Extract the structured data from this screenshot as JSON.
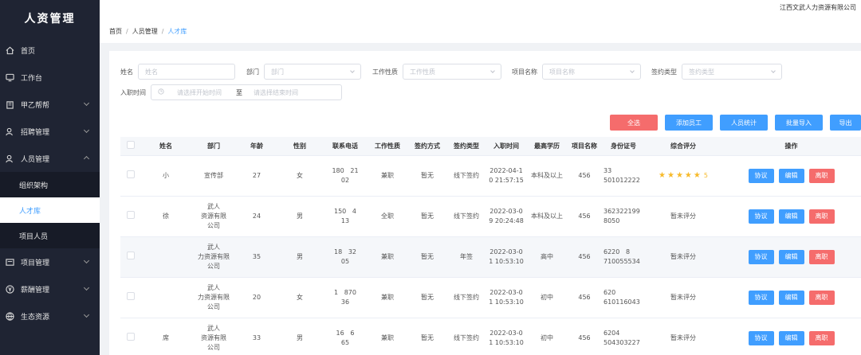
{
  "app": {
    "title": "人资管理",
    "company": "江西文武人力资源有限公司"
  },
  "sidebar": {
    "items": [
      {
        "label": "首页",
        "icon": "home-icon"
      },
      {
        "label": "工作台",
        "icon": "monitor-icon"
      },
      {
        "label": "甲乙帮帮",
        "icon": "building-icon"
      },
      {
        "label": "招聘管理",
        "icon": "user-icon"
      },
      {
        "label": "人员管理",
        "icon": "user-icon"
      },
      {
        "label": "组织架构"
      },
      {
        "label": "人才库"
      },
      {
        "label": "项目人员"
      },
      {
        "label": "项目管理",
        "icon": "folder-icon"
      },
      {
        "label": "薪酬管理",
        "icon": "yen-icon"
      },
      {
        "label": "生态资源",
        "icon": "globe-icon"
      }
    ]
  },
  "breadcrumb": {
    "home": "首页",
    "level2": "人员管理",
    "current": "人才库",
    "sep": "/"
  },
  "filters": {
    "name_label": "姓名",
    "name_placeholder": "姓名",
    "dept_label": "部门",
    "dept_placeholder": "部门",
    "nature_label": "工作性质",
    "nature_placeholder": "工作性质",
    "project_label": "项目名称",
    "project_placeholder": "项目名称",
    "sign_label": "签约类型",
    "sign_placeholder": "签约类型",
    "date_label": "入职时间",
    "date_start_placeholder": "请选择开始时间",
    "date_sep": "至",
    "date_end_placeholder": "请选择结束时间"
  },
  "actions": {
    "all": "全选",
    "add": "添加员工",
    "stats": "人员统计",
    "import": "批量导入",
    "export": "导出"
  },
  "table": {
    "headers": [
      "姓名",
      "部门",
      "年龄",
      "性别",
      "联系电话",
      "工作性质",
      "签约方式",
      "签约类型",
      "入职时间",
      "最高学历",
      "项目名称",
      "身份证号",
      "综合评分",
      "操作"
    ],
    "rows": [
      {
        "name": "小",
        "dept": "宣传部",
        "age": "27",
        "sex": "女",
        "phone1": "180",
        "phone2": "21",
        "phone3": "02",
        "nature": "兼职",
        "sign": "暂无",
        "stype": "线下签约",
        "date1": "2022-04-1",
        "date2": "0 21:57:15",
        "edu": "本科及以上",
        "proj": "456",
        "id1": "33",
        "id2": "501012222",
        "score": "★★★★★",
        "score_num": "5"
      },
      {
        "name": "徐",
        "dept1": "武人",
        "dept2": "资源有限",
        "dept3": "公司",
        "age": "24",
        "sex": "男",
        "phone1": "150",
        "phone2": "4",
        "phone3": "13",
        "nature": "全职",
        "sign": "暂无",
        "stype": "线下签约",
        "date1": "2022-03-0",
        "date2": "9 20:24:48",
        "edu": "本科及以上",
        "proj": "456",
        "id1": "362322199",
        "id2": "8050",
        "score": "暂未评分"
      },
      {
        "name": "",
        "dept1": "武人",
        "dept2": "力资源有限",
        "dept3": "公司",
        "age": "35",
        "sex": "男",
        "phone1": "18",
        "phone2": "32",
        "phone3": "05",
        "nature": "兼职",
        "sign": "暂无",
        "stype": "年签",
        "date1": "2022-03-0",
        "date2": "1 10:53:10",
        "edu": "高中",
        "proj": "456",
        "id1": "6220",
        "id2": "8",
        "id3": "710055534",
        "score": "暂未评分"
      },
      {
        "name": "",
        "dept1": "武人",
        "dept2": "力资源有限",
        "dept3": "公司",
        "age": "20",
        "sex": "女",
        "phone1": "1",
        "phone2": "870",
        "phone3": "36",
        "nature": "兼职",
        "sign": "暂无",
        "stype": "线下签约",
        "date1": "2022-03-0",
        "date2": "1 10:53:10",
        "edu": "初中",
        "proj": "456",
        "id1": "620",
        "id2": "610116043",
        "score": "暂未评分"
      },
      {
        "name": "席",
        "dept1": "武人",
        "dept2": "资源有限",
        "dept3": "公司",
        "age": "33",
        "sex": "男",
        "phone1": "16",
        "phone2": "6",
        "phone3": "65",
        "nature": "兼职",
        "sign": "暂无",
        "stype": "线下签约",
        "date1": "2022-03-0",
        "date2": "1 10:53:10",
        "edu": "初中",
        "proj": "456",
        "id1": "6204",
        "id2": "504303227",
        "score": "暂未评分"
      }
    ],
    "ops": {
      "agreement": "协议",
      "edit": "编辑",
      "leave": "离职"
    }
  }
}
